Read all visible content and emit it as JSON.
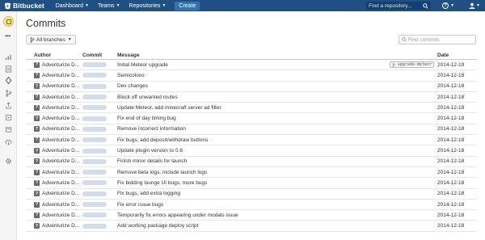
{
  "topbar": {
    "brand": "Bitbucket",
    "nav": [
      {
        "label": "Dashboard"
      },
      {
        "label": "Teams"
      },
      {
        "label": "Repositories"
      }
    ],
    "create_label": "Create",
    "search_placeholder": "Find a repository...",
    "help_glyph": "?",
    "bg_color": "#205081"
  },
  "sidebar": {
    "dots": "•••",
    "icons": [
      "stats-icon",
      "overview-icon",
      "source-icon",
      "branches-icon",
      "pull-requests-icon",
      "downloads-icon",
      "pipelines-icon",
      "deploy-icon",
      "settings-icon"
    ]
  },
  "main": {
    "title": "Commits",
    "branch_selector": "All branches",
    "find_placeholder": "Find commits",
    "columns": {
      "author": "Author",
      "commit": "Commit",
      "message": "Message",
      "date": "Date"
    },
    "rows": [
      {
        "author": "Adventurize D...",
        "message": "Initial Meteor upgrade",
        "date": "2014-12-19",
        "tag": "upgrade-meteor"
      },
      {
        "author": "Adventurize D...",
        "message": "Semicolons",
        "date": "2014-12-18"
      },
      {
        "author": "Adventurize D...",
        "message": "Dev changes",
        "date": "2014-12-18"
      },
      {
        "author": "Adventurize D...",
        "message": "Block off unwanted routes",
        "date": "2014-12-18"
      },
      {
        "author": "Adventurize D...",
        "message": "Update Meteor, add minecraft server ad filter",
        "date": "2014-12-18"
      },
      {
        "author": "Adventurize D...",
        "message": "Fix end of day timing bug",
        "date": "2014-12-18"
      },
      {
        "author": "Adventurize D...",
        "message": "Remove incorrect information",
        "date": "2014-12-18"
      },
      {
        "author": "Adventurize D...",
        "message": "Fix bugs, add deposit/withdraw buttons",
        "date": "2014-12-18"
      },
      {
        "author": "Adventurize D...",
        "message": "Update plugin version to 0.6",
        "date": "2014-12-18"
      },
      {
        "author": "Adventurize D...",
        "message": "Finish minor details for launch",
        "date": "2014-12-18"
      },
      {
        "author": "Adventurize D...",
        "message": "Remove beta logs, include launch logs",
        "date": "2014-12-18"
      },
      {
        "author": "Adventurize D...",
        "message": "Fix bidding lounge UI bugs, more bugs",
        "date": "2014-12-18"
      },
      {
        "author": "Adventurize D...",
        "message": "Fix bugs, add extra logging",
        "date": "2014-12-18"
      },
      {
        "author": "Adventurize D...",
        "message": "Fix error issue bugs",
        "date": "2014-12-18"
      },
      {
        "author": "Adventurize D...",
        "message": "Temporarily fix errors appearing under modals issue",
        "date": "2014-12-18"
      },
      {
        "author": "Adventurize D...",
        "message": "Add working package deploy script",
        "date": "2014-12-18"
      }
    ]
  }
}
